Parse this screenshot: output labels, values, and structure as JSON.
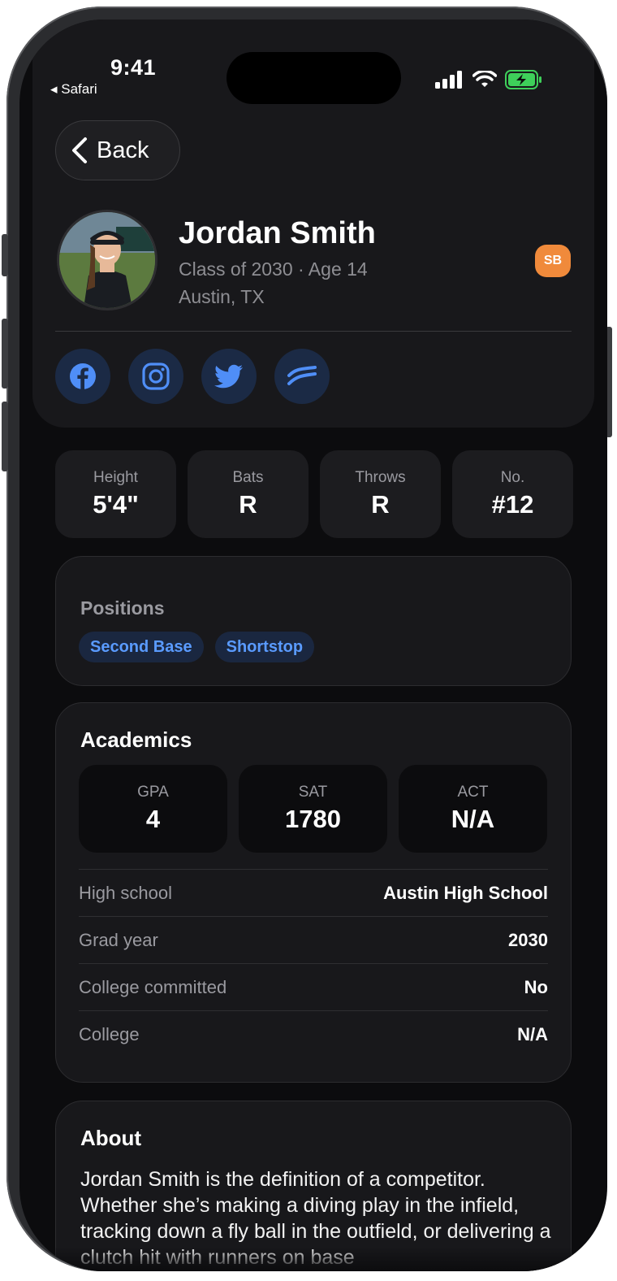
{
  "status_bar": {
    "time": "9:41",
    "back_app": "◂ Safari"
  },
  "nav": {
    "back_label": "Back"
  },
  "profile": {
    "name": "Jordan Smith",
    "class_age": "Class of 2030 · Age 14",
    "location": "Austin, TX",
    "sport_badge": "SB",
    "sport_badge_color": "#f08a3b",
    "socials": [
      "facebook-icon",
      "instagram-icon",
      "twitter-icon",
      "wave-icon"
    ]
  },
  "stats": [
    {
      "label": "Height",
      "value": "5'4\""
    },
    {
      "label": "Bats",
      "value": "R"
    },
    {
      "label": "Throws",
      "value": "R"
    },
    {
      "label": "No.",
      "value": "#12"
    }
  ],
  "positions": {
    "title": "Positions",
    "items": [
      "Second Base",
      "Shortstop"
    ]
  },
  "academics": {
    "title": "Academics",
    "scores": [
      {
        "label": "GPA",
        "value": "4"
      },
      {
        "label": "SAT",
        "value": "1780"
      },
      {
        "label": "ACT",
        "value": "N/A"
      }
    ],
    "rows": [
      {
        "label": "High school",
        "value": "Austin High School"
      },
      {
        "label": "Grad year",
        "value": "2030"
      },
      {
        "label": "College committed",
        "value": "No"
      },
      {
        "label": "College",
        "value": "N/A"
      }
    ]
  },
  "about": {
    "title": "About",
    "text": "Jordan Smith is the definition of a competitor. Whether she’s making a diving play in the infield, tracking down a fly ball in the outfield, or delivering a clutch hit with runners on base"
  },
  "colors": {
    "accent": "#5a9bff",
    "background": "#0c0c0e",
    "card": "#18181b"
  }
}
